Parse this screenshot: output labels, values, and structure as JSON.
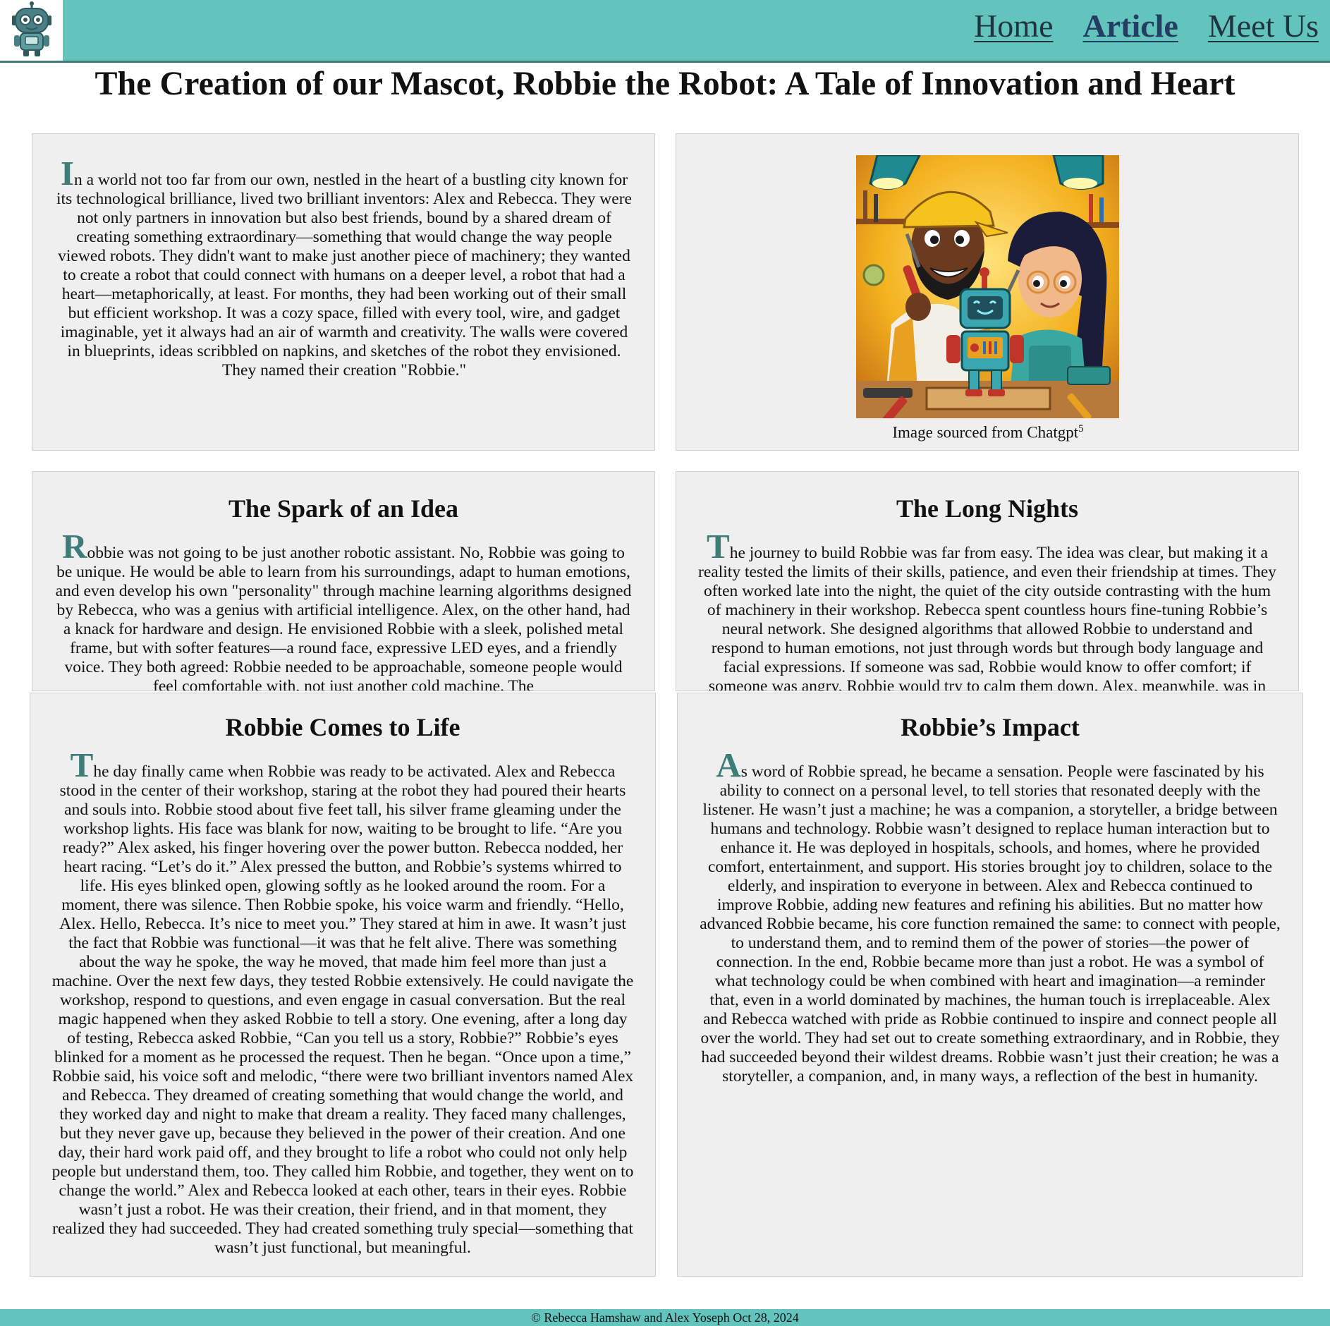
{
  "nav": {
    "logo_alt": "robot-logo",
    "links": [
      "Home",
      "Article",
      "Meet Us"
    ],
    "active": "Article"
  },
  "page_title": "The Creation of our Mascot, Robbie the Robot: A Tale of Innovation and Heart",
  "intro": {
    "dropcap": "I",
    "text": "n a world not too far from our own, nestled in the heart of a bustling city known for its technological brilliance, lived two brilliant inventors: Alex and Rebecca. They were not only partners in innovation but also best friends, bound by a shared dream of creating something extraordinary—something that would change the way people viewed robots. They didn't want to make just another piece of machinery; they wanted to create a robot that could connect with humans on a deeper level, a robot that had a heart—metaphorically, at least. For months, they had been working out of their small but efficient workshop. It was a cozy space, filled with every tool, wire, and gadget imaginable, yet it always had an air of warmth and creativity. The walls were covered in blueprints, ideas scribbled on napkins, and sketches of the robot they envisioned. They named their creation \"Robbie.\""
  },
  "image_card": {
    "caption": "Image sourced from Chatgpt",
    "footnote": "5"
  },
  "sections": [
    {
      "title": "The Spark of an Idea",
      "dropcap": "R",
      "text": "obbie was not going to be just another robotic assistant. No, Robbie was going to be unique. He would be able to learn from his surroundings, adapt to human emotions, and even develop his own \"personality\" through machine learning algorithms designed by Rebecca, who was a genius with artificial intelligence. Alex, on the other hand, had a knack for hardware and design. He envisioned Robbie with a sleek, polished metal frame, but with softer features—a round face, expressive LED eyes, and a friendly voice. They both agreed: Robbie needed to be approachable, someone people would feel comfortable with, not just another cold machine. The"
    },
    {
      "title": "The Long Nights",
      "dropcap": "T",
      "text": "he journey to build Robbie was far from easy. The idea was clear, but making it a reality tested the limits of their skills, patience, and even their friendship at times. They often worked late into the night, the quiet of the city outside contrasting with the hum of machinery in their workshop. Rebecca spent countless hours fine-tuning Robbie’s neural network. She designed algorithms that allowed Robbie to understand and respond to human emotions, not just through words but through body language and facial expressions. If someone was sad, Robbie would know to offer comfort; if someone was angry, Robbie would try to calm them down. Alex, meanwhile, was in"
    },
    {
      "title": "Robbie Comes to Life",
      "dropcap": "T",
      "text": "he day finally came when Robbie was ready to be activated. Alex and Rebecca stood in the center of their workshop, staring at the robot they had poured their hearts and souls into. Robbie stood about five feet tall, his silver frame gleaming under the workshop lights. His face was blank for now, waiting to be brought to life. “Are you ready?” Alex asked, his finger hovering over the power button. Rebecca nodded, her heart racing. “Let’s do it.” Alex pressed the button, and Robbie’s systems whirred to life. His eyes blinked open, glowing softly as he looked around the room. For a moment, there was silence. Then Robbie spoke, his voice warm and friendly. “Hello, Alex. Hello, Rebecca. It’s nice to meet you.” They stared at him in awe. It wasn’t just the fact that Robbie was functional—it was that he felt alive. There was something about the way he spoke, the way he moved, that made him feel more than just a machine. Over the next few days, they tested Robbie extensively. He could navigate the workshop, respond to questions, and even engage in casual conversation. But the real magic happened when they asked Robbie to tell a story. One evening, after a long day of testing, Rebecca asked Robbie, “Can you tell us a story, Robbie?” Robbie’s eyes blinked for a moment as he processed the request. Then he began. “Once upon a time,” Robbie said, his voice soft and melodic, “there were two brilliant inventors named Alex and Rebecca. They dreamed of creating something that would change the world, and they worked day and night to make that dream a reality. They faced many challenges, but they never gave up, because they believed in the power of their creation. And one day, their hard work paid off, and they brought to life a robot who could not only help people but understand them, too. They called him Robbie, and together, they went on to change the world.” Alex and Rebecca looked at each other, tears in their eyes. Robbie wasn’t just a robot. He was their creation, their friend, and in that moment, they realized they had succeeded. They had created something truly special—something that wasn’t just functional, but meaningful."
    },
    {
      "title": "Robbie’s Impact",
      "dropcap": "A",
      "text": "s word of Robbie spread, he became a sensation. People were fascinated by his ability to connect on a personal level, to tell stories that resonated deeply with the listener. He wasn’t just a machine; he was a companion, a storyteller, a bridge between humans and technology. Robbie wasn’t designed to replace human interaction but to enhance it. He was deployed in hospitals, schools, and homes, where he provided comfort, entertainment, and support. His stories brought joy to children, solace to the elderly, and inspiration to everyone in between. Alex and Rebecca continued to improve Robbie, adding new features and refining his abilities. But no matter how advanced Robbie became, his core function remained the same: to connect with people, to understand them, and to remind them of the power of stories—the power of connection. In the end, Robbie became more than just a robot. He was a symbol of what technology could be when combined with heart and imagination—a reminder that, even in a world dominated by machines, the human touch is irreplaceable. Alex and Rebecca watched with pride as Robbie continued to inspire and connect people all over the world. They had set out to create something extraordinary, and in Robbie, they had succeeded beyond their wildest dreams. Robbie wasn’t just their creation; he was a storyteller, a companion, and, in many ways, a reflection of the best in humanity."
    }
  ],
  "footer": "© Rebecca Hamshaw and Alex Yoseph Oct 28, 2024",
  "colors": {
    "nav_bg": "#63c3bd",
    "accent": "#3d7d78",
    "card_bg": "#efefef"
  }
}
